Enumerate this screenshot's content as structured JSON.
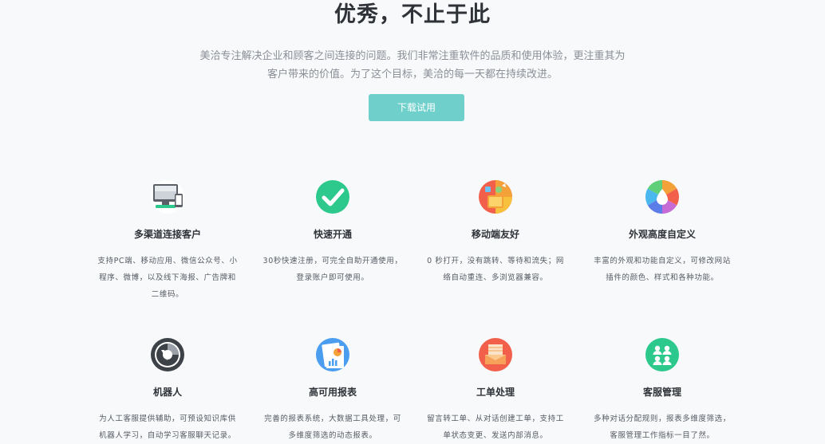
{
  "hero": {
    "title": "优秀，不止于此",
    "desc_line1": "美洽专注解决企业和顾客之间连接的问题。我们非常注重软件的品质和使用体验，更注重其为",
    "desc_line2": "客户带来的价值。为了这个目标，美洽的每一天都在持续改进。",
    "cta_label": "下载试用"
  },
  "features": [
    {
      "title": "多渠道连接客户",
      "desc": [
        "支持PC端、移动应用、微信公众号、小",
        "程序、微博，以及线下海报、广告牌和",
        "二维码。"
      ],
      "icon": "monitor-phone-icon"
    },
    {
      "title": "快速开通",
      "desc": [
        "30秒快速注册，可完全自助开通使用，",
        "登录账户即可使用。"
      ],
      "icon": "checkmark-icon"
    },
    {
      "title": "移动端友好",
      "desc": [
        "0 秒打开，没有跳转、等待和流失；网",
        "络自动重连、多浏览器兼容。"
      ],
      "icon": "mobile-friendly-icon"
    },
    {
      "title": "外观高度自定义",
      "desc": [
        "丰富的外观和功能自定义，可修改网站",
        "插件的颜色、样式和各种功能。"
      ],
      "icon": "color-wheel-icon"
    },
    {
      "title": "机器人",
      "desc": [
        "为人工客服提供辅助，可预设知识库供",
        "机器人学习，自动学习客服聊天记录。"
      ],
      "icon": "robot-icon"
    },
    {
      "title": "高可用报表",
      "desc": [
        "完善的报表系统，大数据工具处理，可",
        "多维度筛选的动态报表。"
      ],
      "icon": "report-icon"
    },
    {
      "title": "工单处理",
      "desc": [
        "留言转工单、从对话创建工单，支持工",
        "单状态变更、发送内部消息。"
      ],
      "icon": "ticket-icon"
    },
    {
      "title": "客服管理",
      "desc": [
        "多种对话分配规则，报表多维度筛选，",
        "客服管理工作指标一目了然。"
      ],
      "icon": "team-icon"
    }
  ],
  "colors": {
    "cta": "#6fd0cb",
    "green": "#2dc98c",
    "orange_red": "#f2604c",
    "blue": "#4b9df0",
    "dark": "#3d4248"
  }
}
